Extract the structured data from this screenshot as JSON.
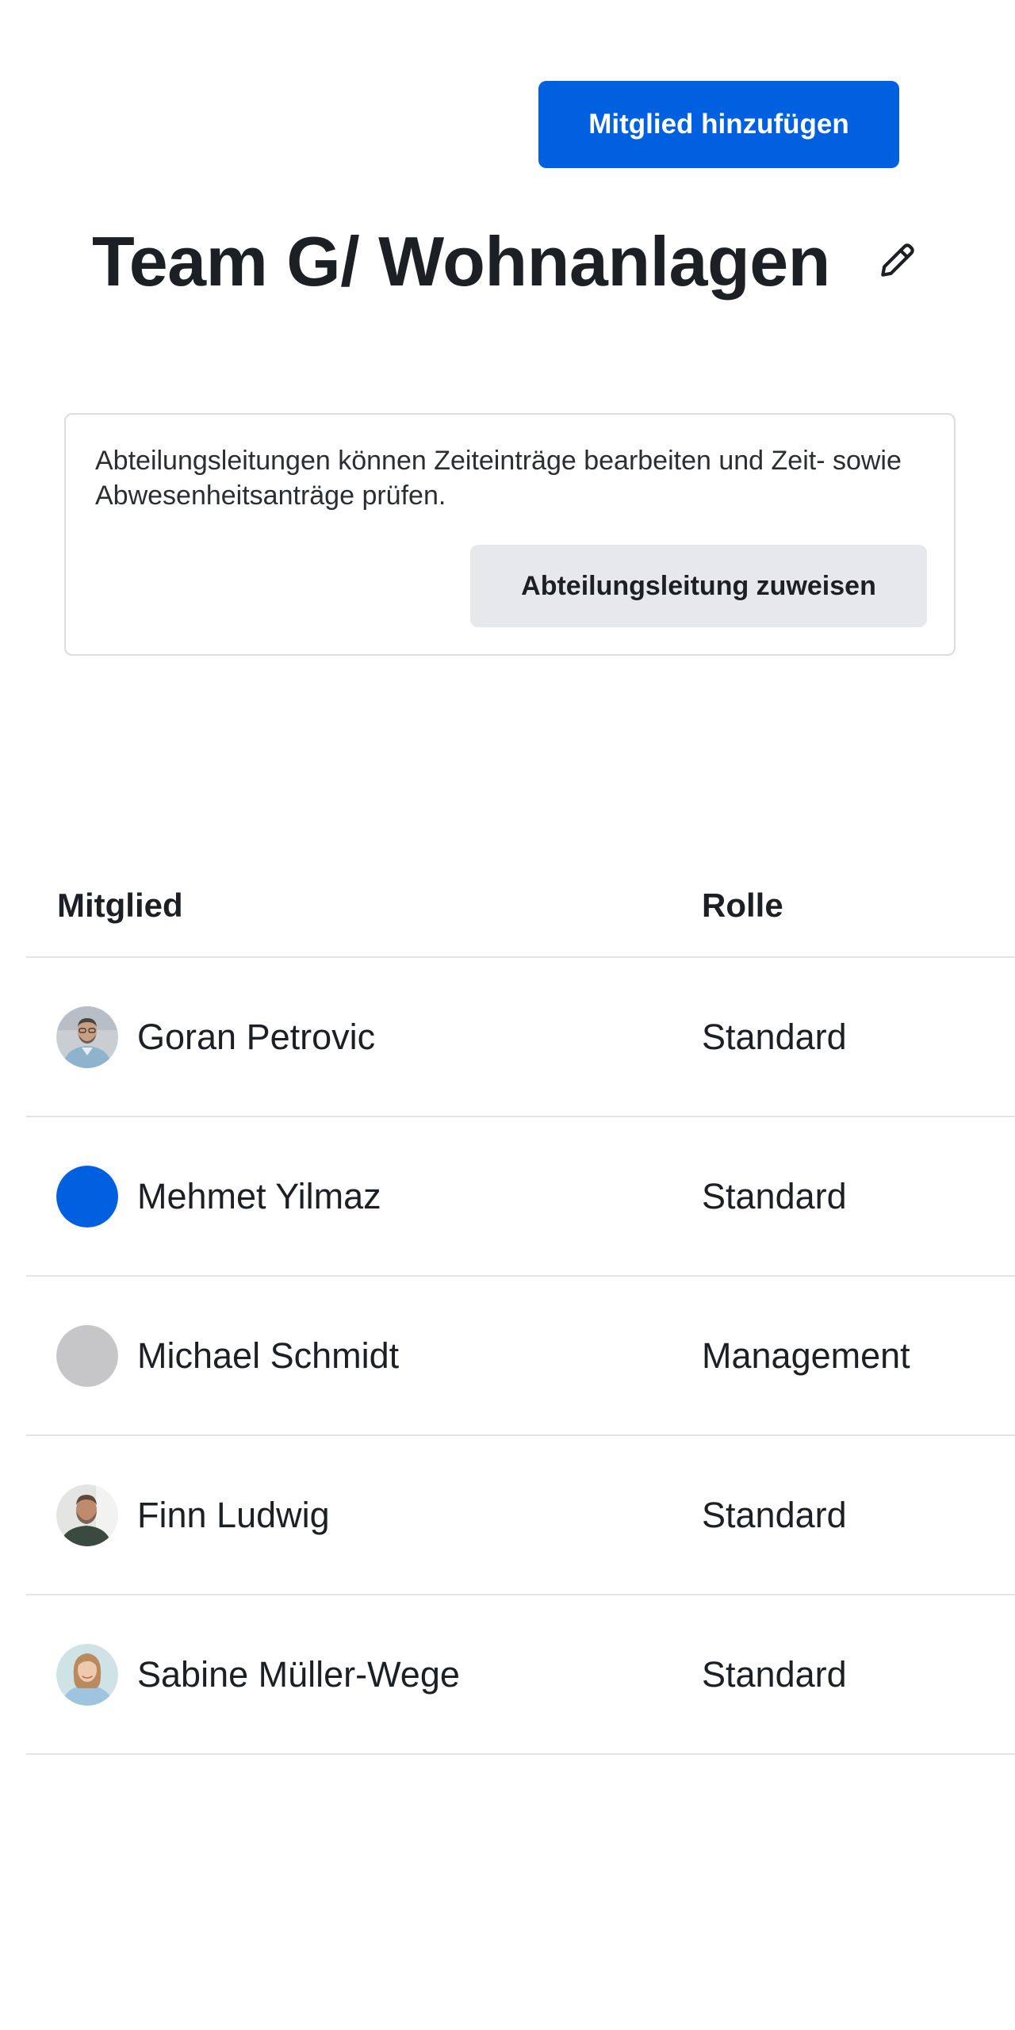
{
  "header": {
    "add_member_label": "Mitglied hinzufügen",
    "title": "Team G/ Wohnanlagen",
    "edit_icon": "pencil-icon"
  },
  "info_box": {
    "text": "Abteilungsleitungen können Zeiteinträge bearbeiten und Zeit- sowie Abwesenheitsanträge prüfen.",
    "assign_label": "Abteilungsleitung zuweisen"
  },
  "table": {
    "columns": {
      "member": "Mitglied",
      "role": "Rolle"
    },
    "rows": [
      {
        "name": "Goran Petrovic",
        "role": "Standard",
        "avatar": "photo-man-glasses"
      },
      {
        "name": "Mehmet Yilmaz",
        "role": "Standard",
        "avatar": "solid-blue",
        "avatar_color": "#0060df"
      },
      {
        "name": "Michael Schmidt",
        "role": "Management",
        "avatar": "solid-gray",
        "avatar_color": "#c6c6c8"
      },
      {
        "name": "Finn Ludwig",
        "role": "Standard",
        "avatar": "photo-man-beard"
      },
      {
        "name": "Sabine Müller-Wege",
        "role": "Standard",
        "avatar": "photo-woman"
      }
    ]
  },
  "colors": {
    "primary": "#0060df",
    "secondary_button": "#e7e8eb",
    "divider": "#e3e4e7",
    "text": "#1c1f23"
  }
}
